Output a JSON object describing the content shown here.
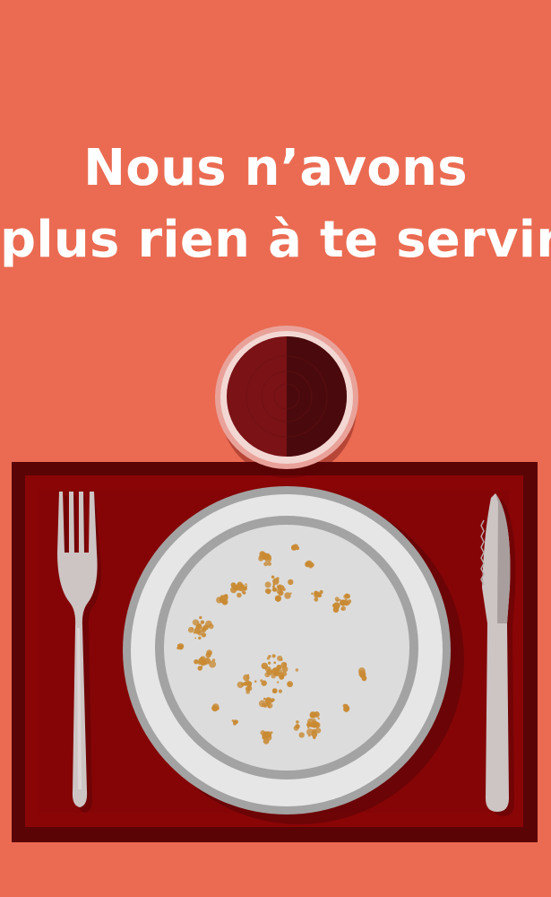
{
  "headline": {
    "line1": "Nous n’avons",
    "line2": "plus rien à te servir."
  },
  "icons": {
    "glass": "wine-glass-icon",
    "plate": "empty-plate-icon",
    "fork": "fork-icon",
    "knife": "knife-icon",
    "crumbs": "crumbs-icon"
  },
  "colors": {
    "background": "#EA6B52",
    "placemat_dark": "#5A0406",
    "placemat_mid": "#8A0506",
    "plate_rim_outer": "#A3A3A3",
    "plate_face": "#E6E6E6",
    "plate_inner_ring": "#A3A3A3",
    "plate_center": "#DCDCDC",
    "cutlery_light": "#CDC4C4",
    "cutlery_shade": "#A89E9E",
    "wine": "#7A1216",
    "wine_dark": "#4A0A0D",
    "crumb": "#C98A33",
    "text": "#FFFFFF"
  }
}
